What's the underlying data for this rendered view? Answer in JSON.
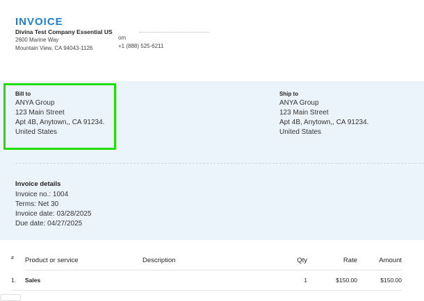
{
  "header": {
    "title": "INVOICE",
    "company": "Divina Test Company Essential US",
    "address1": "2600 Marine Way",
    "address2": "Mountain View, CA 94043-1126",
    "email_partial": "om",
    "phone": "+1 (888) 525-6211"
  },
  "bill_to": {
    "label": "Bill to",
    "lines": [
      "ANYA Group",
      "123 Main Street",
      "Apt 4B, Anytown,, CA 91234.",
      "United States"
    ]
  },
  "ship_to": {
    "label": "Ship to",
    "lines": [
      "ANYA Group",
      "123 Main Street",
      "Apt 4B, Anytown,, CA 91234.",
      "United States"
    ]
  },
  "details": {
    "label": "Invoice details",
    "lines": [
      "Invoice no.: 1004",
      "Terms: Net 30",
      "Invoice date: 03/28/2025",
      "Due date: 04/27/2025"
    ]
  },
  "table": {
    "columns": [
      "#",
      "Product or service",
      "Description",
      "Qty",
      "Rate",
      "Amount"
    ],
    "rows": [
      {
        "num": "1.",
        "product": "Sales",
        "description": "",
        "qty": "1",
        "rate": "$150.00",
        "amount": "$150.00"
      }
    ]
  },
  "colors": {
    "accent": "#1a7fd0",
    "highlight": "#22dd00",
    "band": "#ebf3fb"
  }
}
